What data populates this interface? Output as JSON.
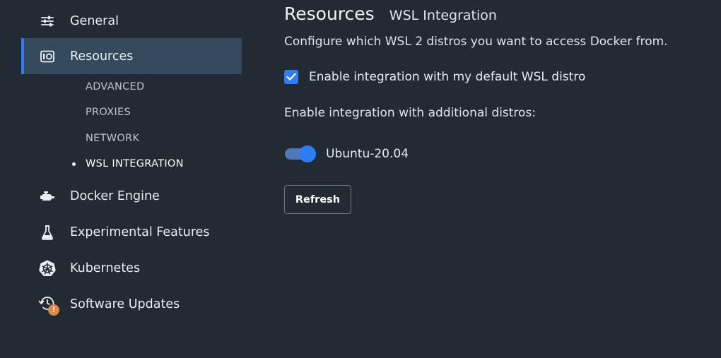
{
  "sidebar": {
    "items": [
      {
        "id": "general",
        "label": "General",
        "icon": "sliders-icon"
      },
      {
        "id": "resources",
        "label": "Resources",
        "icon": "resources-icon",
        "active": true
      },
      {
        "id": "docker-engine",
        "label": "Docker Engine",
        "icon": "engine-icon"
      },
      {
        "id": "experimental",
        "label": "Experimental Features",
        "icon": "flask-icon"
      },
      {
        "id": "kubernetes",
        "label": "Kubernetes",
        "icon": "kubernetes-icon"
      },
      {
        "id": "software-updates",
        "label": "Software Updates",
        "icon": "update-icon",
        "badge": "!"
      }
    ],
    "subitems": [
      {
        "label": "ADVANCED"
      },
      {
        "label": "PROXIES"
      },
      {
        "label": "NETWORK"
      },
      {
        "label": "WSL INTEGRATION",
        "current": true
      }
    ]
  },
  "main": {
    "title": "Resources",
    "subtitle": "WSL Integration",
    "description": "Configure which WSL 2 distros you want to access Docker from.",
    "default_distro": {
      "label": "Enable integration with my default WSL distro",
      "checked": true
    },
    "additional_label": "Enable integration with additional distros:",
    "distros": [
      {
        "name": "Ubuntu-20.04",
        "enabled": true
      }
    ],
    "refresh_label": "Refresh"
  },
  "colors": {
    "background": "#222b33",
    "active_bg": "#344a5c",
    "accent": "#2f7df6",
    "badge": "#e0874a"
  }
}
